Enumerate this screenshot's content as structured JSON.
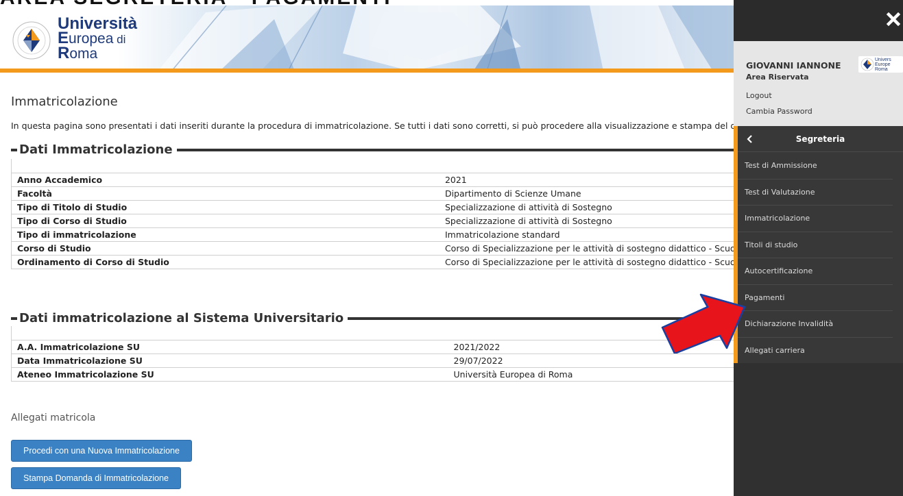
{
  "top_caption": "AREA SEGRETERIA - PAGAMENTI",
  "header": {
    "logo_line1": "Università",
    "logo_line2_big": "E",
    "logo_line2_rest": "uropea",
    "logo_line2_small": " di",
    "logo_line3_big": "R",
    "logo_line3_rest": "oma",
    "seal_text": "VINCE IN BONO MALUM"
  },
  "main": {
    "page_title": "Immatricolazione",
    "intro": "In questa pagina sono presentati i dati inseriti durante la procedura di immatricolazione. Se tutti i dati sono corretti, si può procedere alla visualizzazione e stampa del docum",
    "section1_title": "Dati Immatricolazione",
    "section1_rows": [
      {
        "label": "Anno Accademico",
        "value": "2021"
      },
      {
        "label": "Facoltà",
        "value": "Dipartimento di Scienze Umane"
      },
      {
        "label": "Tipo di Titolo di Studio",
        "value": "Specializzazione di attività di Sostegno"
      },
      {
        "label": "Tipo di Corso di Studio",
        "value": "Specializzazione di attività di Sostegno"
      },
      {
        "label": "Tipo di immatricolazione",
        "value": "Immatricolazione standard"
      },
      {
        "label": "Corso di Studio",
        "value": "Corso di Specializzazione per le attività di sostegno didattico - Scuol"
      },
      {
        "label": "Ordinamento di Corso di Studio",
        "value": "Corso di Specializzazione per le attività di sostegno didattico - Scuol"
      }
    ],
    "section2_title": "Dati immatricolazione al Sistema Universitario",
    "section2_rows": [
      {
        "label": "A.A. Immatricolazione SU",
        "value": "2021/2022"
      },
      {
        "label": "Data Immatricolazione SU",
        "value": "29/07/2022"
      },
      {
        "label": "Ateneo Immatricolazione SU",
        "value": "Università Europea di Roma"
      }
    ],
    "attachments_title": "Allegati matricola",
    "btn_new": "Procedi con una Nuova Immatricolazione",
    "btn_print": "Stampa Domanda di Immatricolazione"
  },
  "side_panel": {
    "user_name": "GIOVANNI IANNONE",
    "user_logo_text": "Univers Europe Roma",
    "area_riservata": "Area Riservata",
    "logout": "Logout",
    "cambia_password": "Cambia Password",
    "menu_title": "Segreteria",
    "menu_items": [
      "Test di Ammissione",
      "Test di Valutazione",
      "Immatricolazione",
      "Titoli di studio",
      "Autocertificazione",
      "Pagamenti",
      "Dichiarazione Invalidità",
      "Allegati carriera"
    ]
  },
  "colors": {
    "accent_orange": "#f39a1d",
    "button_blue": "#3b82c4",
    "panel_dark": "#303030",
    "annotation_red": "#e8141b",
    "logo_blue": "#1e3a7a"
  }
}
